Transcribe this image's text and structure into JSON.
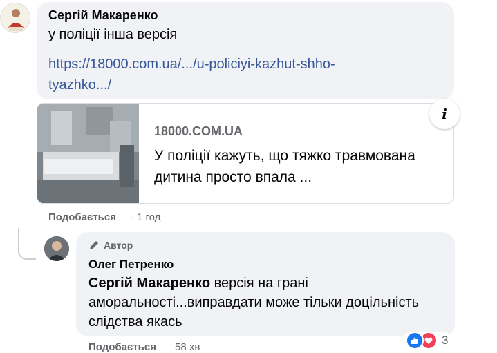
{
  "comment": {
    "author": "Сергій Макаренко",
    "text": "у поліції інша версія",
    "link": "https://18000.com.ua/.../u-policiyi-kazhut-shho-tyazhko.../",
    "preview": {
      "domain": "18000.COM.UA",
      "title": "У поліції кажуть, що тяжко травмована дитина просто впала ..."
    },
    "actions": {
      "like_label": "Подобається",
      "separator": "·",
      "time": "1 год"
    }
  },
  "reply": {
    "badge": "Автор",
    "author": "Олег Петренко",
    "mention": "Сергій Макаренко",
    "text": " версія на грані аморальності...виправдати може тільки доцільність слідства якась",
    "actions": {
      "like_label": "Подобається",
      "time": "58 хв"
    },
    "reactions": {
      "types": [
        "like-icon",
        "love-icon"
      ],
      "count": "3"
    }
  },
  "colors": {
    "bubble": "#f0f2f5",
    "link": "#385898",
    "meta": "#65676b",
    "like": "#1877f2",
    "love": "#f33e58"
  }
}
